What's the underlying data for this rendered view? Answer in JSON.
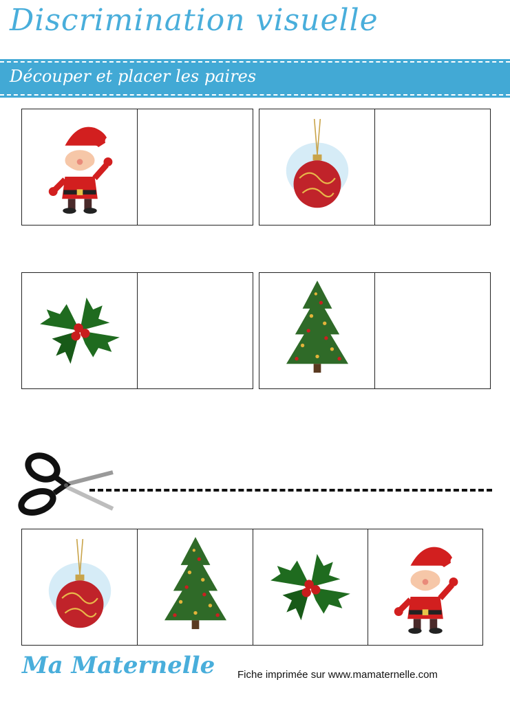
{
  "header": {
    "title": "Discrimination visuelle",
    "instruction": "Découper et placer les paires"
  },
  "colors": {
    "accent": "#42a9d5",
    "title": "#49aedb"
  },
  "pairs": [
    {
      "image": "santa-claus"
    },
    {
      "image": "christmas-ornament"
    },
    {
      "image": "holly"
    },
    {
      "image": "christmas-tree"
    }
  ],
  "cutouts": [
    "christmas-ornament",
    "christmas-tree",
    "holly",
    "santa-claus"
  ],
  "footer": {
    "brand": "Ma Maternelle",
    "credit": "Fiche imprimée sur www.mamaternelle.com"
  }
}
